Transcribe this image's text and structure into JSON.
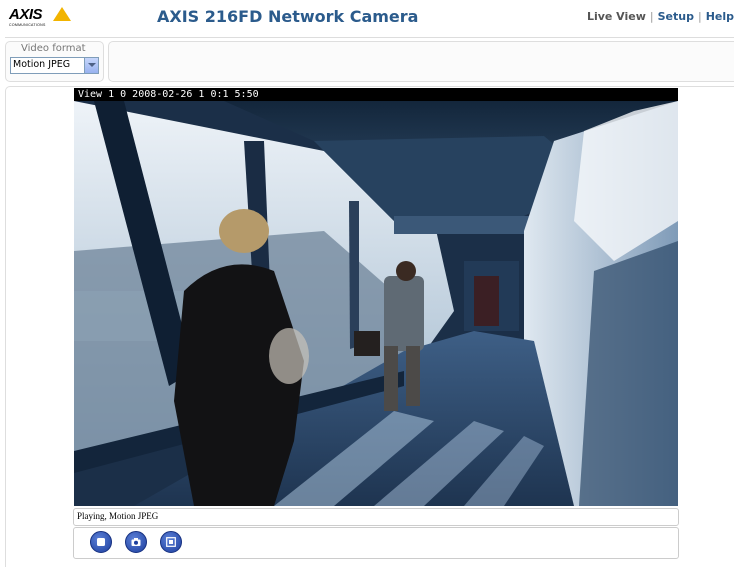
{
  "header": {
    "logo_text": "AXIS",
    "logo_subtext": "COMMUNICATIONS",
    "title": "AXIS 216FD Network Camera",
    "nav": {
      "live_view": "Live View",
      "setup": "Setup",
      "help": "Help",
      "separator": "|"
    }
  },
  "video_format": {
    "label": "Video format",
    "selected": "Motion JPEG"
  },
  "video": {
    "overlay_text": "View 1 0 2008-02-26 1 0:1 5:50"
  },
  "status": {
    "text": "Playing, Motion JPEG"
  },
  "controls": {
    "icons": [
      "stop-icon",
      "snapshot-icon",
      "fullscreen-icon"
    ]
  },
  "colors": {
    "title": "#2b5b8c",
    "logo_accent": "#f2b400",
    "button": "#1d3f9e"
  }
}
